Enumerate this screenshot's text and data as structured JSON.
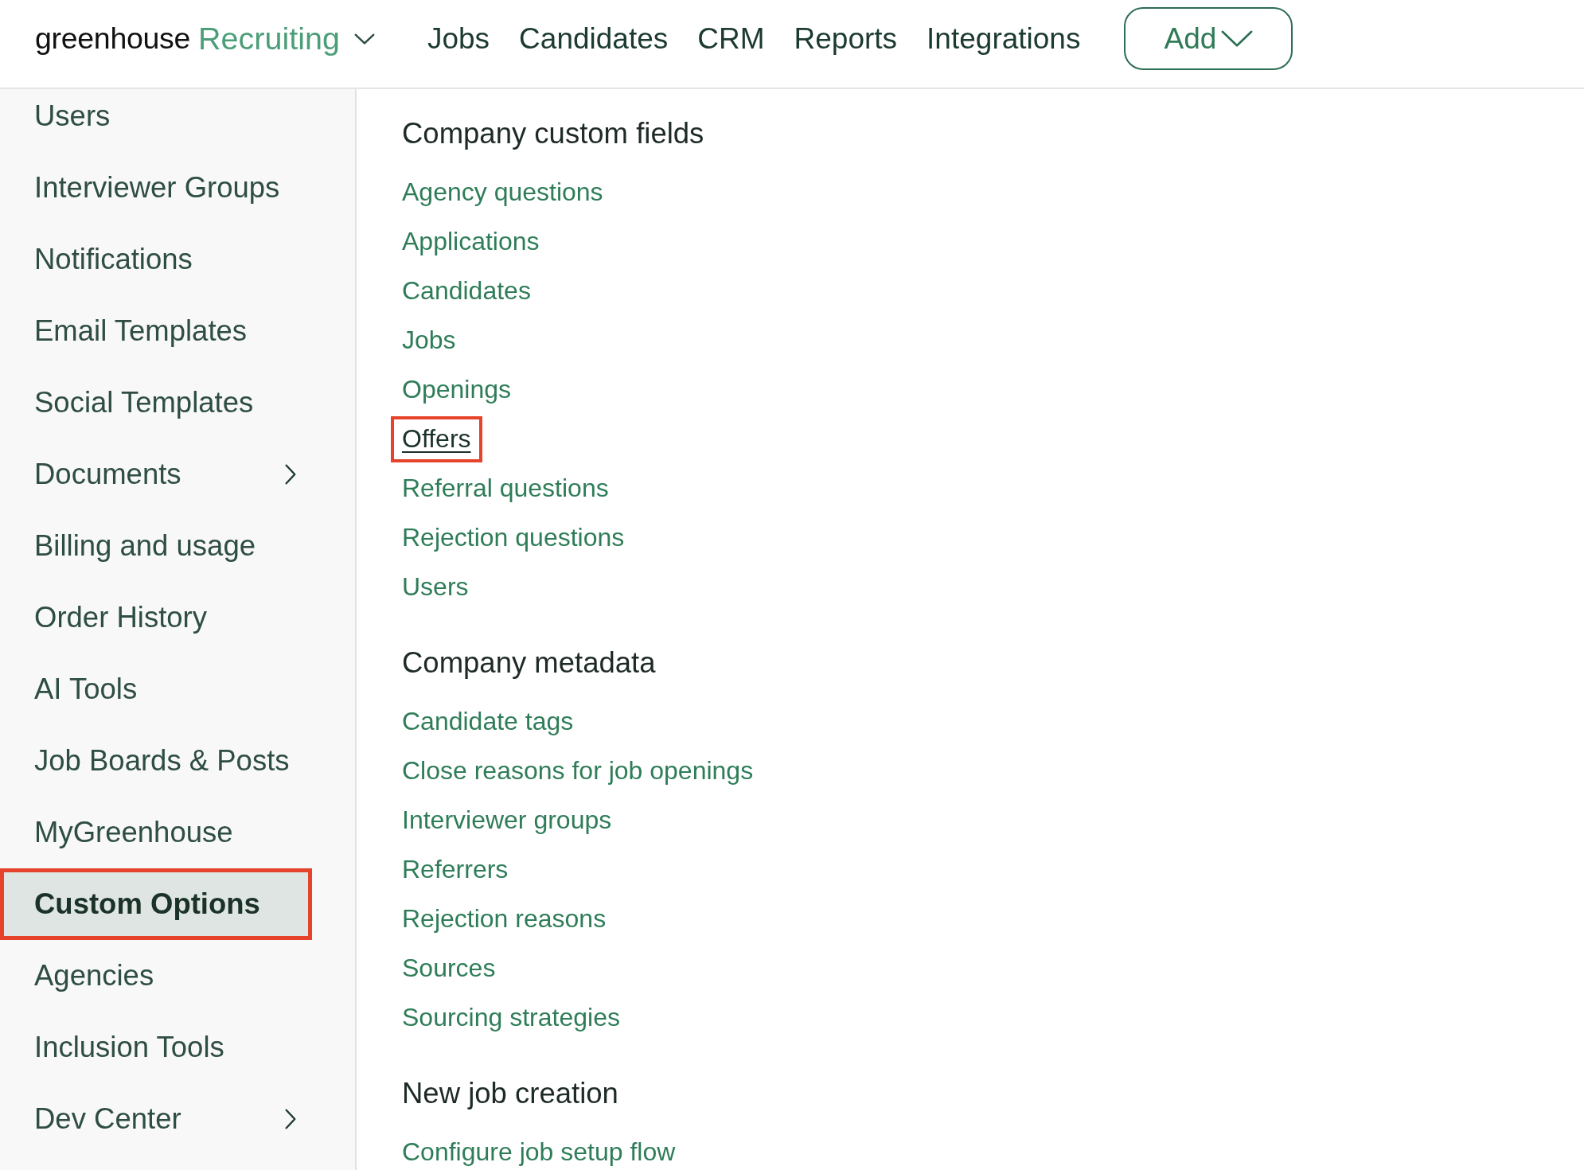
{
  "header": {
    "brand": "greenhouse",
    "product": "Recruiting",
    "nav": [
      "Jobs",
      "Candidates",
      "CRM",
      "Reports",
      "Integrations"
    ],
    "add_button": "Add"
  },
  "sidebar": {
    "items": [
      {
        "label": "Users",
        "selected": false,
        "highlighted": false,
        "expandable": false
      },
      {
        "label": "Interviewer Groups",
        "selected": false,
        "highlighted": false,
        "expandable": false
      },
      {
        "label": "Notifications",
        "selected": false,
        "highlighted": false,
        "expandable": false
      },
      {
        "label": "Email Templates",
        "selected": false,
        "highlighted": false,
        "expandable": false
      },
      {
        "label": "Social Templates",
        "selected": false,
        "highlighted": false,
        "expandable": false
      },
      {
        "label": "Documents",
        "selected": false,
        "highlighted": false,
        "expandable": true
      },
      {
        "label": "Billing and usage",
        "selected": false,
        "highlighted": false,
        "expandable": false
      },
      {
        "label": "Order History",
        "selected": false,
        "highlighted": false,
        "expandable": false
      },
      {
        "label": "AI Tools",
        "selected": false,
        "highlighted": false,
        "expandable": false
      },
      {
        "label": "Job Boards & Posts",
        "selected": false,
        "highlighted": false,
        "expandable": false
      },
      {
        "label": "MyGreenhouse",
        "selected": false,
        "highlighted": false,
        "expandable": false
      },
      {
        "label": "Custom Options",
        "selected": true,
        "highlighted": true,
        "expandable": false
      },
      {
        "label": "Agencies",
        "selected": false,
        "highlighted": false,
        "expandable": false
      },
      {
        "label": "Inclusion Tools",
        "selected": false,
        "highlighted": false,
        "expandable": false
      },
      {
        "label": "Dev Center",
        "selected": false,
        "highlighted": false,
        "expandable": true
      }
    ]
  },
  "content": {
    "sections": [
      {
        "title": "Company custom fields",
        "links": [
          {
            "label": "Agency questions",
            "highlighted": false
          },
          {
            "label": "Applications",
            "highlighted": false
          },
          {
            "label": "Candidates",
            "highlighted": false
          },
          {
            "label": "Jobs",
            "highlighted": false
          },
          {
            "label": "Openings",
            "highlighted": false
          },
          {
            "label": "Offers",
            "highlighted": true
          },
          {
            "label": "Referral questions",
            "highlighted": false
          },
          {
            "label": "Rejection questions",
            "highlighted": false
          },
          {
            "label": "Users",
            "highlighted": false
          }
        ]
      },
      {
        "title": "Company metadata",
        "links": [
          {
            "label": "Candidate tags",
            "highlighted": false
          },
          {
            "label": "Close reasons for job openings",
            "highlighted": false
          },
          {
            "label": "Interviewer groups",
            "highlighted": false
          },
          {
            "label": "Referrers",
            "highlighted": false
          },
          {
            "label": "Rejection reasons",
            "highlighted": false
          },
          {
            "label": "Sources",
            "highlighted": false
          },
          {
            "label": "Sourcing strategies",
            "highlighted": false
          }
        ]
      },
      {
        "title": "New job creation",
        "links": [
          {
            "label": "Configure job setup flow",
            "highlighted": false
          }
        ]
      }
    ]
  }
}
